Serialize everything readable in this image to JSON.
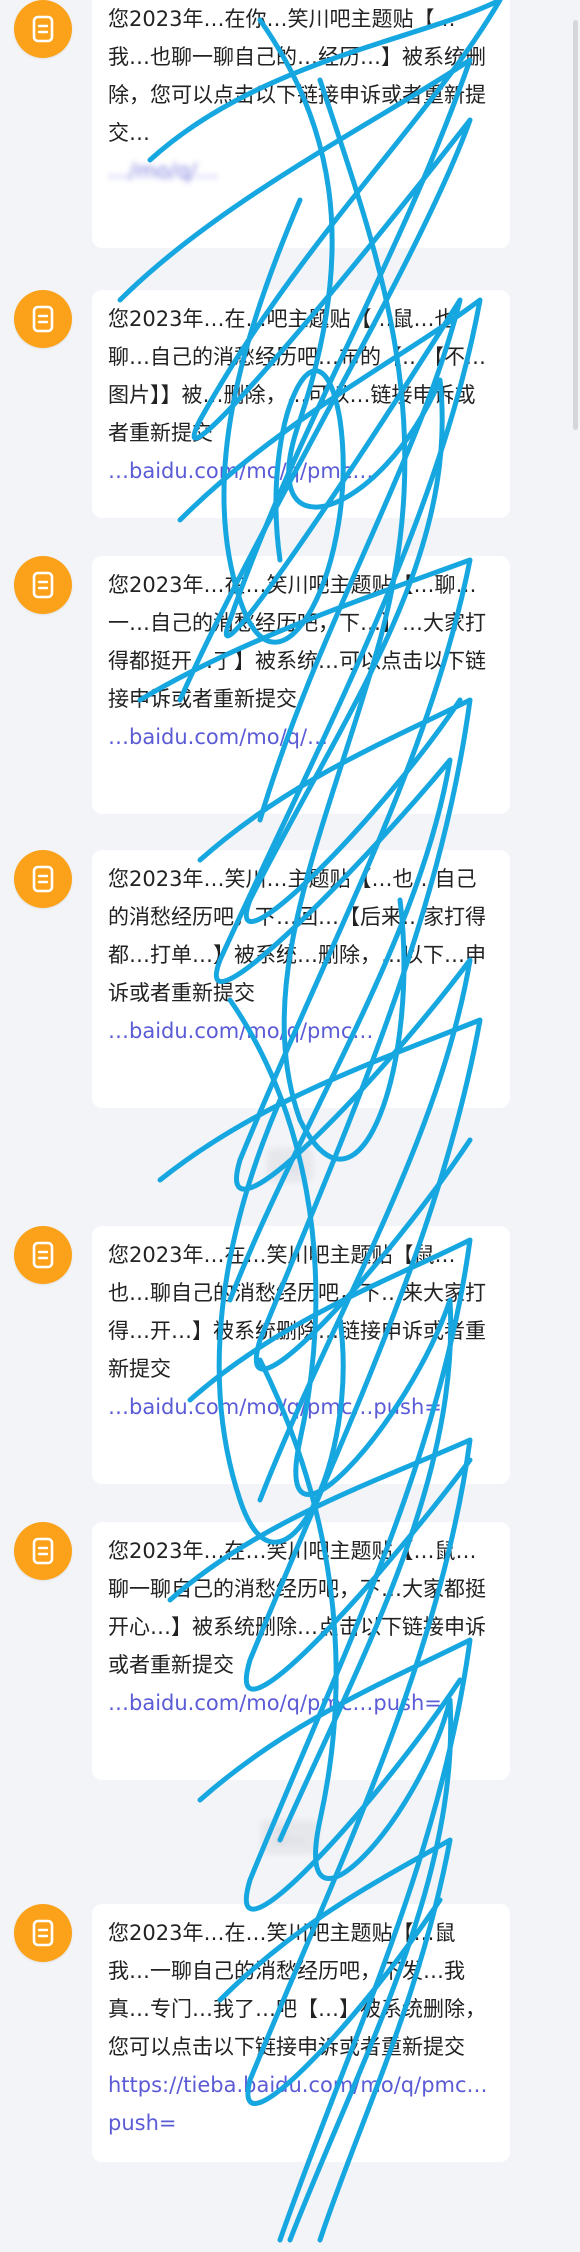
{
  "messages": [
    {
      "text": "您2023年…在你…笑川吧主题贴【…我…也聊一聊自己的…经历…】被系统删除，您可以点击以下链接申诉或者重新提交…",
      "link": "…/mo/q/…"
    },
    {
      "text": "您2023年…在…吧主题贴【…鼠…也聊…自己的消愁经历吧…布的【…【不…图片】】被…删除，…可以…链接申诉或者重新提交",
      "link": "…baidu.com/mo/q/pmc…"
    },
    {
      "text": "您2023年…在…笑川吧主题贴【…聊…一…自己的消愁经历吧，下…】…大家打得都挺开…了】被系统…可以点击以下链接申诉或者重新提交",
      "link": "…baidu.com/mo/q/…"
    },
    {
      "text": "您2023年…笑川…主题贴【…也…自己的消愁经历吧，下…回…【后来…家打得都…打单…】被系统…删除，…以下…申诉或者重新提交",
      "link": "…baidu.com/mo/q/pmc…"
    },
    {
      "text": "您2023年…在…笑川吧主题贴【鼠…也…聊自己的消愁经历吧，下…来大家打得…开…】被系统删除…链接申诉或者重新提交",
      "link": "…baidu.com/mo/q/pmc…push="
    },
    {
      "text": "您2023年…在…笑川吧主题贴【…鼠…聊一聊自己的消愁经历吧，下…大家都挺开心…】被系统删除…点击以下链接申诉或者重新提交",
      "link": "…baidu.com/mo/q/pmc…push="
    },
    {
      "text": "您2023年…在…笑川吧主题贴【…鼠我…一聊自己的消愁经历吧，下发…我真…专门…我了…吧【…】被系统删除，您可以点击以下链接申诉或者重新提交",
      "link": "https://tieba.baidu.com/mo/q/pmc…push="
    }
  ],
  "timestamps": [
    "…",
    "2…"
  ],
  "icons": {
    "avatar": "document-icon"
  },
  "colors": {
    "avatar": "#fba21a",
    "link": "#5b5bd6",
    "scribble": "#17a7e0",
    "background": "#f3f4f8"
  }
}
